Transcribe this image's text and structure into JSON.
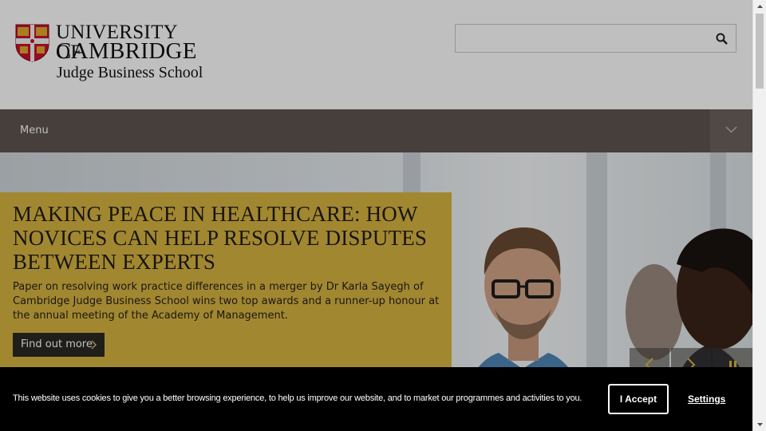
{
  "header": {
    "logo_line1": "UNIVERSITY OF",
    "logo_line2": "CAMBRIDGE",
    "logo_line3": "Judge Business School",
    "search": {
      "placeholder": "",
      "value": ""
    }
  },
  "nav": {
    "menu_label": "Menu"
  },
  "hero": {
    "title": "MAKING PEACE IN HEALTHCARE: HOW NOVICES CAN HELP RESOLVE DISPUTES BETWEEN EXPERTS",
    "description": "Paper on resolving work practice differences in a merger by Dr Karla Sayegh of Cambridge Judge Business School wins two top awards and a runner-up honour at the annual meeting of the Academy of Management.",
    "cta_label": "Find out more"
  },
  "cookie": {
    "text": "This website uses cookies to give you a better browsing experience, to help us improve our website, and to market our programmes and activities to you.",
    "accept_label": "I Accept",
    "settings_label": "Settings"
  },
  "colors": {
    "nav_bg": "#5e554f",
    "caption_bg": "#d9b542",
    "banner_bg": "#000000",
    "cta_bg": "#2b2824"
  },
  "icons": [
    "university-shield-icon",
    "search-icon",
    "chevron-down-icon",
    "chevron-right-icon",
    "prev-arrow-icon",
    "next-arrow-icon",
    "pause-icon"
  ]
}
